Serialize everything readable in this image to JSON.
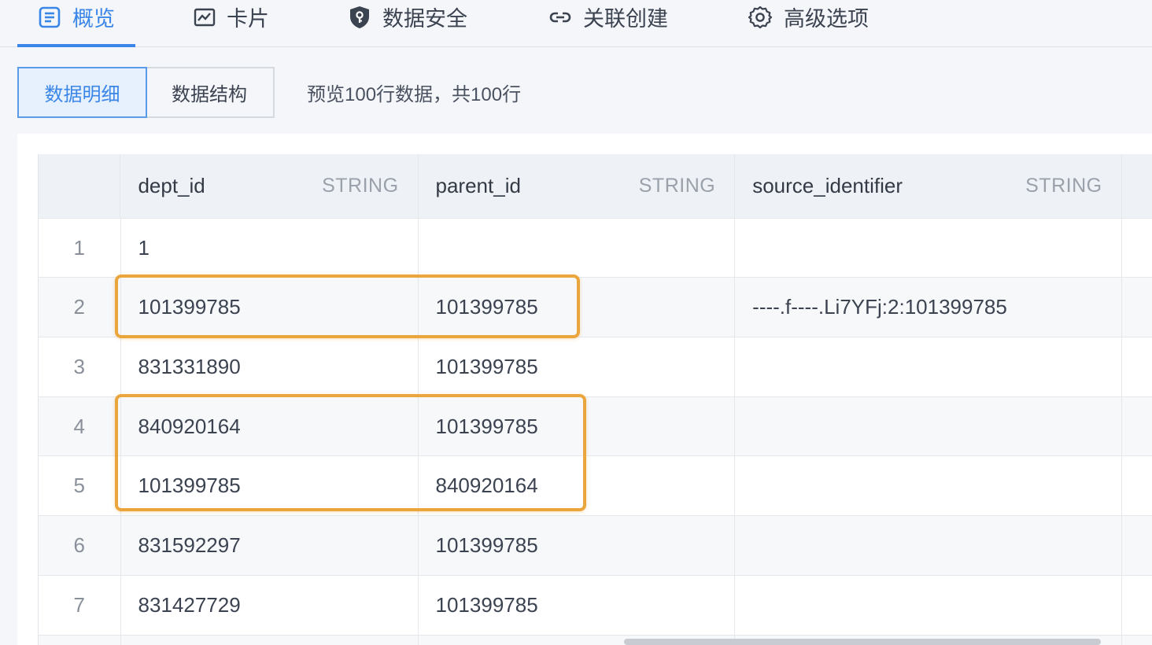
{
  "tabs": [
    {
      "label": "概览",
      "icon": "document-list-icon",
      "active": true
    },
    {
      "label": "卡片",
      "icon": "chart-card-icon",
      "active": false
    },
    {
      "label": "数据安全",
      "icon": "shield-key-icon",
      "active": false
    },
    {
      "label": "关联创建",
      "icon": "link-icon",
      "active": false
    },
    {
      "label": "高级选项",
      "icon": "gear-icon",
      "active": false
    }
  ],
  "toolbar": {
    "detail_label": "数据明细",
    "structure_label": "数据结构",
    "preview_text": "预览100行数据，共100行"
  },
  "colors": {
    "accent": "#3a86e8",
    "highlight": "#eaa63c"
  },
  "table": {
    "columns": [
      {
        "name": "dept_id",
        "type": "STRING"
      },
      {
        "name": "parent_id",
        "type": "STRING"
      },
      {
        "name": "source_identifier",
        "type": "STRING"
      }
    ],
    "rows": [
      {
        "index": "1",
        "dept_id": "1",
        "parent_id": "",
        "source_identifier": ""
      },
      {
        "index": "2",
        "dept_id": "101399785",
        "parent_id": "101399785",
        "source_identifier": "----.f----.Li7YFj:2:101399785"
      },
      {
        "index": "3",
        "dept_id": "831331890",
        "parent_id": "101399785",
        "source_identifier": ""
      },
      {
        "index": "4",
        "dept_id": "840920164",
        "parent_id": "101399785",
        "source_identifier": ""
      },
      {
        "index": "5",
        "dept_id": "101399785",
        "parent_id": "840920164",
        "source_identifier": ""
      },
      {
        "index": "6",
        "dept_id": "831592297",
        "parent_id": "101399785",
        "source_identifier": ""
      },
      {
        "index": "7",
        "dept_id": "831427729",
        "parent_id": "101399785",
        "source_identifier": ""
      }
    ]
  }
}
